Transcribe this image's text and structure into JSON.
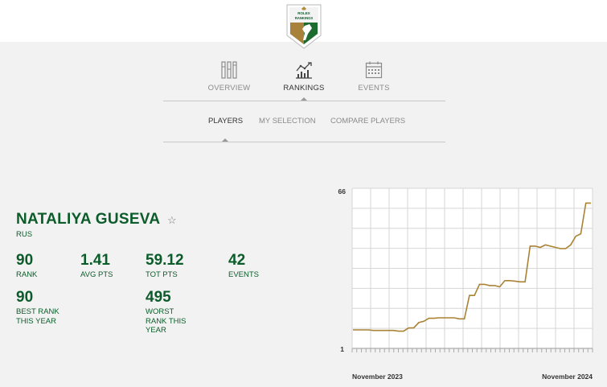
{
  "brand": {
    "logo_line1": "ROLEX",
    "logo_line2": "RANKINGS"
  },
  "main_tabs": [
    {
      "label": "OVERVIEW",
      "icon": "overview-icon",
      "active": false
    },
    {
      "label": "RANKINGS",
      "icon": "rankings-chart-icon",
      "active": true
    },
    {
      "label": "EVENTS",
      "icon": "calendar-icon",
      "active": false
    }
  ],
  "sub_tabs": [
    {
      "label": "PLAYERS",
      "active": true
    },
    {
      "label": "MY SELECTION",
      "active": false
    },
    {
      "label": "COMPARE PLAYERS",
      "active": false
    }
  ],
  "player": {
    "name": "NATALIYA GUSEVA",
    "favorite_icon": "star-outline-icon",
    "country": "RUS",
    "stats": {
      "rank": {
        "value": "90",
        "label": "RANK"
      },
      "avg_pts": {
        "value": "1.41",
        "label": "AVG PTS"
      },
      "tot_pts": {
        "value": "59.12",
        "label": "TOT PTS"
      },
      "events": {
        "value": "42",
        "label": "EVENTS"
      },
      "best_rank": {
        "value": "90",
        "label": "BEST RANK THIS YEAR"
      },
      "worst_rank": {
        "value": "495",
        "label": "WORST RANK THIS YEAR"
      }
    }
  },
  "colors": {
    "brand_green": "#0b5c2a",
    "line_gold": "#a98234",
    "grid": "#d6d6d6"
  },
  "chart_data": {
    "type": "line",
    "title": "",
    "y_top_label": "66",
    "y_bottom_label": "1",
    "ylim": [
      1,
      66
    ],
    "x_start_label": "November 2023",
    "x_end_label": "November 2024",
    "grid": true,
    "series": [
      {
        "values": [
          8.5,
          8.5,
          8.5,
          8.5,
          8.3,
          8.3,
          8.3,
          8.3,
          8.3,
          8.0,
          8.0,
          9.3,
          9.3,
          11.5,
          12.0,
          13.2,
          13.2,
          13.4,
          13.4,
          13.4,
          13.4,
          13.0,
          13.0,
          22.5,
          22.5,
          27.0,
          27.0,
          26.5,
          26.5,
          26.0,
          28.5,
          28.5,
          28.3,
          28.0,
          28.0,
          42.5,
          42.5,
          42.0,
          43.0,
          42.5,
          42.0,
          41.5,
          41.5,
          43.0,
          46.5,
          47.5,
          60.0,
          60.0
        ]
      }
    ]
  }
}
